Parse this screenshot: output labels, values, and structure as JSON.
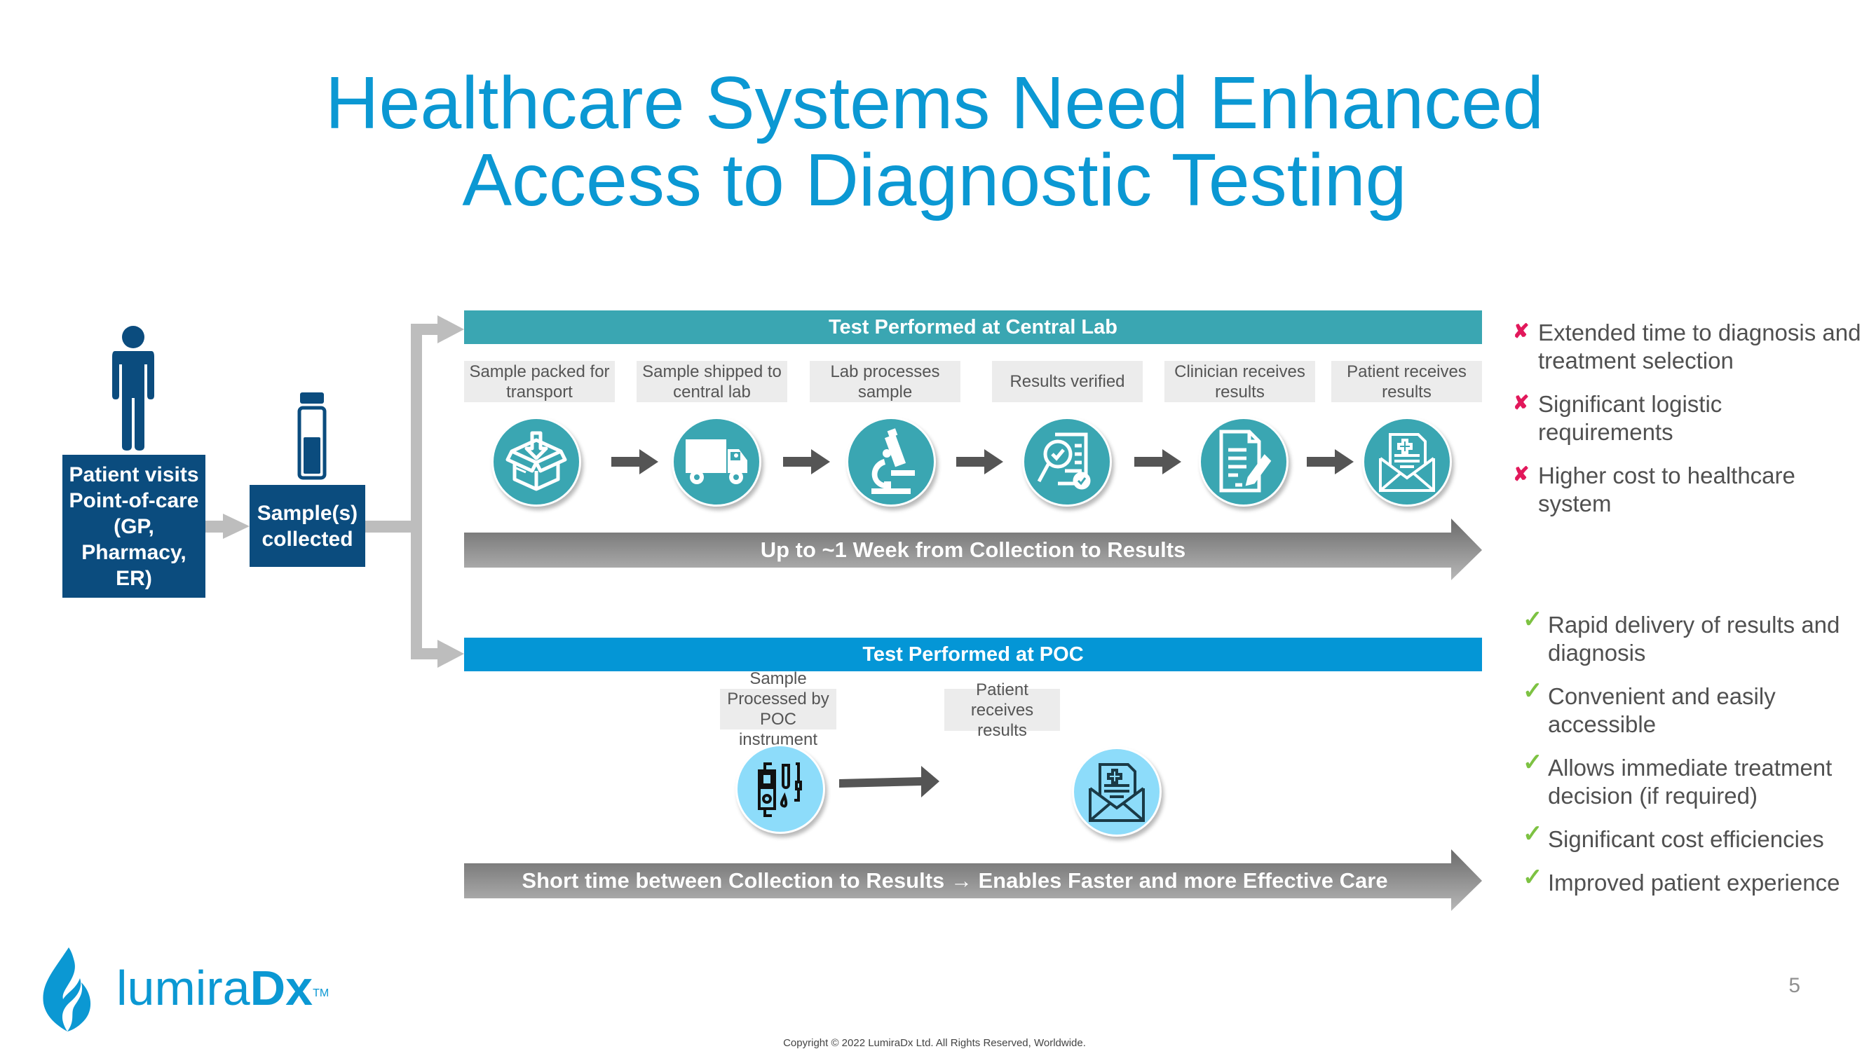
{
  "title": {
    "line1": "Healthcare Systems Need Enhanced",
    "line2": "Access to Diagnostic Testing"
  },
  "left_flow": {
    "patient_box": "Patient visits Point-of-care (GP, Pharmacy, ER)",
    "patient_icon": "person-icon",
    "sample_box": "Sample(s) collected",
    "sample_icon": "sample-vial-icon"
  },
  "central_lab": {
    "header": "Test Performed at Central Lab",
    "steps": [
      {
        "label": "Sample packed for transport",
        "icon": "box-package-icon"
      },
      {
        "label": "Sample shipped to central lab",
        "icon": "delivery-truck-icon"
      },
      {
        "label": "Lab processes sample",
        "icon": "microscope-icon"
      },
      {
        "label": "Results verified",
        "icon": "document-verify-icon"
      },
      {
        "label": "Clinician receives results",
        "icon": "document-edit-icon"
      },
      {
        "label": "Patient receives results",
        "icon": "medical-mail-icon"
      }
    ],
    "banner": "Up to ~1 Week from Collection to Results",
    "drawbacks": [
      "Extended time to diagnosis and treatment selection",
      "Significant logistic requirements",
      "Higher cost to healthcare system"
    ]
  },
  "poc": {
    "header": "Test Performed at POC",
    "steps": [
      {
        "label": "Sample Processed by POC instrument",
        "icon": "poc-instrument-icon"
      },
      {
        "label": "Patient receives results",
        "icon": "medical-mail-icon"
      }
    ],
    "banner": "Short time between Collection to Results → Enables Faster and more Effective Care",
    "benefits": [
      "Rapid delivery of results and diagnosis",
      "Convenient and easily accessible",
      "Allows immediate treatment decision (if required)",
      "Significant cost efficiencies",
      "Improved patient experience"
    ]
  },
  "markers": {
    "negative": "✘",
    "positive": "✓"
  },
  "colors": {
    "title": "#0b98d3",
    "navy": "#0b4c7e",
    "teal": "#3aa6b2",
    "poc_blue": "#0496d6",
    "poc_icon_bg": "#8ddcfa",
    "negative": "#e2185b",
    "positive": "#7dc242"
  },
  "footer": {
    "page_number": "5",
    "copyright": "Copyright © 2022 LumiraDx Ltd. All Rights Reserved, Worldwide.",
    "logo_light": "lumira",
    "logo_bold": "Dx",
    "logo_tm": "TM"
  }
}
